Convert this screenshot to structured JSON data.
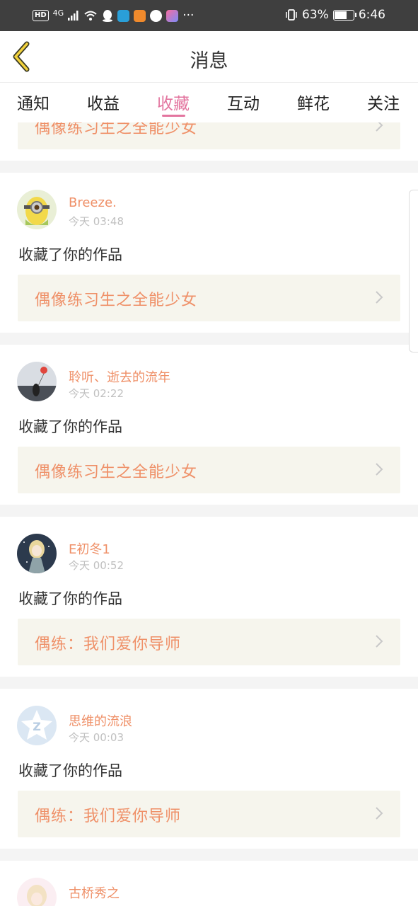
{
  "status_bar": {
    "network": "HD",
    "signal": "4G",
    "battery": "63%",
    "battery_level": 0.63,
    "time": "6:46"
  },
  "header": {
    "title": "消息"
  },
  "tabs": [
    {
      "label": "通知"
    },
    {
      "label": "收益"
    },
    {
      "label": "收藏",
      "active": true
    },
    {
      "label": "互动"
    },
    {
      "label": "鲜花"
    },
    {
      "label": "关注"
    }
  ],
  "colors": {
    "accent": "#e3759f",
    "name": "#ef9068",
    "work_bg": "#f6f5ed"
  },
  "messages": [
    {
      "user": "",
      "time": "",
      "action": "",
      "work": "偶像练习生之全能少女",
      "partial": true
    },
    {
      "user": "Breeze.",
      "time": "今天 03:48",
      "action": "收藏了你的作品",
      "work": "偶像练习生之全能少女",
      "avatar": "minion-avatar"
    },
    {
      "user": "聆听、逝去的流年",
      "time": "今天 02:22",
      "action": "收藏了你的作品",
      "work": "偶像练习生之全能少女",
      "avatar": "balloon-girl-avatar"
    },
    {
      "user": "E初冬1",
      "time": "今天 00:52",
      "action": "收藏了你的作品",
      "work": "偶练：我们爱你导师",
      "avatar": "anime-girl-avatar"
    },
    {
      "user": "思维的流浪",
      "time": "今天 00:03",
      "action": "收藏了你的作品",
      "work": "偶练：我们爱你导师",
      "avatar": "default-z-avatar"
    },
    {
      "user": "古桥秀之",
      "time": "",
      "action": "",
      "work": "",
      "avatar": "anime-pink-avatar"
    }
  ]
}
